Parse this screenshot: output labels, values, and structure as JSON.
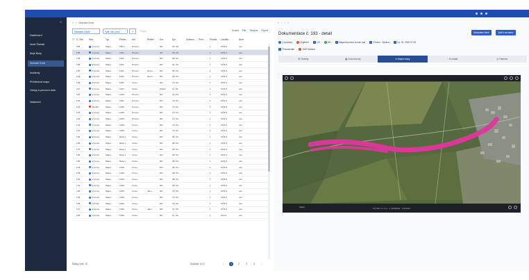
{
  "app": {
    "title": "",
    "user": ""
  },
  "sidebar": {
    "items": [
      {
        "label": "Dashboard"
      },
      {
        "label": "Nové Žádosti"
      },
      {
        "label": "Moje Body"
      },
      {
        "label": "Seznam Kont"
      },
      {
        "label": "Incidenty"
      },
      {
        "label": "Přehledová mapa"
      },
      {
        "label": "Vstupy a provozní data"
      },
      {
        "label": "Nastavení"
      }
    ]
  },
  "breadcrumb": {
    "home_icon": "home-icon",
    "label": "Seznam Kont"
  },
  "filters": {
    "select_label": "Seznam Úlohl",
    "chip_label": "Vyhl. ole: (xxx)",
    "chip_btn": "+",
    "extra": "Pro(c)",
    "actions": [
      "Invece",
      "Filtr",
      "Sloupce",
      "Export"
    ]
  },
  "table": {
    "columns": [
      "Č. Žád.",
      "Stav",
      "Typ",
      "Předm.",
      "Akt.",
      "Řešitel",
      "Kor.",
      "Spr.",
      "Ustaven.",
      "Prod.",
      "Priorita",
      "Lokalita",
      "Akce"
    ],
    "rows": [
      {
        "num": "158",
        "dot": "blue",
        "state": "V proce",
        "type": "Mapa..",
        "pred": "180.1..",
        "akt": "Provoz..",
        "ret": "",
        "kor": "ND",
        "spr": "0V. 05..",
        "ust": "",
        "prod": "",
        "prio": "1",
        "lok": "SÚS K..",
        "akce": "oss"
      },
      {
        "num": "155",
        "dot": "blue",
        "state": "V proce",
        "type": "Mapa..",
        "pred": "1101..",
        "akt": "Provoz..",
        "ret": "",
        "kor": "ND",
        "spr": "05. 05..",
        "ust": "",
        "prod": "",
        "prio": "1",
        "lok": "SÚS K..",
        "akce": "oss"
      },
      {
        "num": "153",
        "dot": "blue",
        "state": "V proce",
        "type": "Mapa..",
        "pred": "1101..",
        "akt": "Provoz..",
        "ret": "",
        "kor": "ND",
        "spr": "05. 04..",
        "ust": "",
        "prod": "",
        "prio": "1",
        "lok": "SÚS K..",
        "akce": "oss"
      },
      {
        "num": "152",
        "dot": "blue",
        "state": "V proce",
        "type": "Mapa..",
        "pred": "1101..",
        "akt": "Provoz..",
        "ret": "",
        "kor": "ND",
        "spr": "00. 04..",
        "ust": "",
        "prod": "",
        "prio": "1",
        "lok": "SÚS K..",
        "akce": "oss"
      },
      {
        "num": "155",
        "dot": "blue",
        "state": "V proce",
        "type": "Mapa..",
        "pred": "1101..",
        "akt": "Provoz..",
        "ret": "Zeme..",
        "kor": "ND",
        "spr": "03. 04..",
        "ust": "",
        "prod": "",
        "prio": "1",
        "lok": "SÚS K..",
        "akce": "oss"
      },
      {
        "num": "149",
        "dot": "blue",
        "state": "V proce",
        "type": "Mapa..",
        "pred": "1411..",
        "akt": "Provoz..",
        "ret": "Zeme..",
        "kor": "ND",
        "spr": "28. 03..",
        "ust": "",
        "prod": "",
        "prio": "1",
        "lok": "SÚS K..",
        "akce": "oss"
      },
      {
        "num": "148",
        "dot": "blue",
        "state": "V proce",
        "type": "Mapa..",
        "pred": "1131..",
        "akt": "Unive..",
        "ret": "",
        "kor": "ND",
        "spr": "15. 02..",
        "ust": "",
        "prod": "",
        "prio": "1",
        "lok": "SÚS K..",
        "akce": "oss"
      },
      {
        "num": "147",
        "dot": "blue",
        "state": "V proce",
        "type": "Mapa..",
        "pred": "1027..",
        "akt": "Unive..",
        "ret": "",
        "kor": "Znácil",
        "spr": "11. 04..",
        "ust": "",
        "prod": "",
        "prio": "1",
        "lok": "SÚS K..",
        "akce": "oss"
      },
      {
        "num": "146",
        "dot": "blue",
        "state": "V proce",
        "type": "Mapa..",
        "pred": "1180..",
        "akt": "Provoz..",
        "ret": "",
        "kor": "ND",
        "spr": "22. 03..",
        "ust": "",
        "prod": "",
        "prio": "1",
        "lok": "SÚS K..",
        "akce": "oss"
      },
      {
        "num": "145",
        "dot": "blue",
        "state": "V proce",
        "type": "Mapa..",
        "pred": "1181..",
        "akt": "Provoz..",
        "ret": "",
        "kor": "ND",
        "spr": "16. 03..",
        "ust": "",
        "prod": "",
        "prio": "1",
        "lok": "SÚS K..",
        "akce": "oss"
      },
      {
        "num": "144",
        "dot": "red",
        "state": "Zamítn.",
        "type": "Mapa..",
        "pred": "1180..",
        "akt": "Provoz..",
        "ret": "",
        "kor": "ND",
        "spr": "13. 02..",
        "ust": "",
        "prod": "",
        "prio": "1",
        "lok": "SÚS K..",
        "akce": "oss"
      },
      {
        "num": "143",
        "dot": "blue",
        "state": "V proce",
        "type": "Mapa..",
        "pred": "1180..",
        "akt": "Provoz..",
        "ret": "",
        "kor": "ND",
        "spr": "13. 04..",
        "ust": "",
        "prod": "",
        "prio": "1",
        "lok": "SÚS K..",
        "akce": "oss"
      },
      {
        "num": "142",
        "dot": "blue",
        "state": "V proce",
        "type": "Mapa..",
        "pred": "1180..",
        "akt": "Provoz..",
        "ret": "",
        "kor": "ND",
        "spr": "13. 04..",
        "ust": "",
        "prod": "",
        "prio": "1",
        "lok": "SÚS K..",
        "akce": "oss"
      },
      {
        "num": "141",
        "dot": "blue",
        "state": "V proce",
        "type": "Mapa..",
        "pred": "1180..",
        "akt": "Unive..",
        "ret": "",
        "kor": "ND",
        "spr": "15. 04..",
        "ust": "",
        "prod": "",
        "prio": "1",
        "lok": "SÚS K..",
        "akce": "oss"
      },
      {
        "num": "140",
        "dot": "blue",
        "state": "V proce",
        "type": "Mapa..",
        "pred": "1180..",
        "akt": "Unive..",
        "ret": "",
        "kor": "ND",
        "spr": "15. 04..",
        "ust": "",
        "prod": "",
        "prio": "1",
        "lok": "SÚS K..",
        "akce": "oss"
      },
      {
        "num": "139",
        "dot": "blue",
        "state": "V proce",
        "type": "Mapa..",
        "pred": "Nasu t..",
        "akt": "Unive..",
        "ret": "",
        "kor": "ND",
        "spr": "08. 04..",
        "ust": "",
        "prod": "",
        "prio": "1",
        "lok": "SÚS K..",
        "akce": "oss"
      },
      {
        "num": "138",
        "dot": "blue",
        "state": "V proce",
        "type": "Mapa..",
        "pred": "Nasu t..",
        "akt": "Unive..",
        "ret": "",
        "kor": "ND",
        "spr": "08. 04..",
        "ust": "",
        "prod": "",
        "prio": "1",
        "lok": "SÚS K..",
        "akce": "oss"
      },
      {
        "num": "137",
        "dot": "blue",
        "state": "V proce",
        "type": "Mapa..",
        "pred": "Nasu t..",
        "akt": "Unive..",
        "ret": "",
        "kor": "ND",
        "spr": "08. 04..",
        "ust": "",
        "prod": "",
        "prio": "1",
        "lok": "SÚS K..",
        "akce": "oss"
      },
      {
        "num": "136",
        "dot": "blue",
        "state": "V proce",
        "type": "Mapa..",
        "pred": "Nasu t..",
        "akt": "Unive..",
        "ret": "",
        "kor": "ND",
        "spr": "08. 03..",
        "ust": "",
        "prod": "",
        "prio": "1",
        "lok": "SÚS K..",
        "akce": "oss"
      },
      {
        "num": "135",
        "dot": "blue",
        "state": "V proce",
        "type": "Mapa..",
        "pred": "Nasu t..",
        "akt": "Unive..",
        "ret": "",
        "kor": "ND",
        "spr": "08. 03..",
        "ust": "",
        "prod": "",
        "prio": "1",
        "lok": "SÚS K..",
        "akce": "oss"
      },
      {
        "num": "134",
        "dot": "blue",
        "state": "V proce",
        "type": "Mapa..",
        "pred": "1020..",
        "akt": "Unive..",
        "ret": "",
        "kor": "ND",
        "spr": "08. 03..",
        "ust": "",
        "prod": "",
        "prio": "1",
        "lok": "SÚS K..",
        "akce": "oss"
      },
      {
        "num": "133",
        "dot": "blue",
        "state": "V proce",
        "type": "Mapa..",
        "pred": "1020..",
        "akt": "Unive..",
        "ret": "",
        "kor": "ND",
        "spr": "08. 03..",
        "ust": "",
        "prod": "",
        "prio": "1",
        "lok": "SÚS K..",
        "akce": "oss"
      },
      {
        "num": "132",
        "dot": "blue",
        "state": "V proce",
        "type": "Mapa..",
        "pred": "1020..",
        "akt": "Unive..",
        "ret": "",
        "kor": "ND",
        "spr": "08. 03..",
        "ust": "",
        "prod": "",
        "prio": "1",
        "lok": "SÚS K..",
        "akce": "oss"
      },
      {
        "num": "131",
        "dot": "blue",
        "state": "V proce",
        "type": "Mapa..",
        "pred": "1020..",
        "akt": "Unive..",
        "ret": "",
        "kor": "ND",
        "spr": "08. 03..",
        "ust": "",
        "prod": "",
        "prio": "1",
        "lok": "SÚS K..",
        "akce": "oss"
      },
      {
        "num": "130",
        "dot": "blue",
        "state": "V proce",
        "type": "Mapa..",
        "pred": "1020..",
        "akt": "Unive..",
        "ret": "Jahn..",
        "kor": "ND",
        "spr": "15. 03..",
        "ust": "",
        "prod": "",
        "prio": "1",
        "lok": "SÚS K..",
        "akce": "oss"
      },
      {
        "num": "129",
        "dot": "blue",
        "state": "V proce",
        "type": "Mapa..",
        "pred": "1020..",
        "akt": "Unive..",
        "ret": "",
        "kor": "ND",
        "spr": "13. 03..",
        "ust": "",
        "prod": "",
        "prio": "1",
        "lok": "SÚS K..",
        "akce": "oss"
      },
      {
        "num": "128",
        "dot": "blue",
        "state": "Schvál.",
        "type": "Mapa..",
        "pred": "1020..",
        "akt": "Unive..",
        "ret": "",
        "kor": "ND",
        "spr": "16. 03..",
        "ust": "",
        "prod": "",
        "prio": "1",
        "lok": "SÚS K..",
        "akce": "oss"
      },
      {
        "num": "127",
        "dot": "blue",
        "state": "V proce",
        "type": "Mapa..",
        "pred": "1020..",
        "akt": "Unive..",
        "ret": "Jahn..",
        "kor": "ND",
        "spr": "14. 03..",
        "ust": "",
        "prod": "",
        "prio": "1",
        "lok": "SÚS K..",
        "akce": "oss"
      },
      {
        "num": "126",
        "dot": "blue",
        "state": "V proce",
        "type": "Mapa..",
        "pred": "1020..",
        "akt": "Unive..",
        "ret": "",
        "kor": "ND",
        "spr": "11. 03..",
        "ust": "",
        "prod": "",
        "prio": "1",
        "lok": "Zvolá..",
        "akce": "oss"
      }
    ]
  },
  "pagination": {
    "count": "Řádky celé: 10",
    "per_page": "Zobrazit: 10 ▾",
    "pages": [
      "‹",
      "1",
      "2",
      "3",
      "4",
      "›"
    ]
  },
  "detail": {
    "nav": [
      "«",
      "‹",
      "›",
      "»"
    ],
    "title": "Dokumentace č. 193 - detail",
    "btn1": "Akceptace Akce",
    "btn2": "Zpět k seznamu",
    "info1": [
      {
        "icon": "blue",
        "text": "V procesu"
      },
      {
        "icon": "red",
        "text": "Urgentní"
      },
      {
        "icon": "sq",
        "text": "1/3"
      },
      {
        "icon": "green",
        "text": "ND"
      },
      {
        "icon": "sq",
        "text": "Mapová pomoc zvoucí nad"
      },
      {
        "icon": "sq",
        "text": "Provoz - Správa"
      },
      {
        "icon": "sq",
        "text": "Cs. 02. 2024 07:19"
      }
    ],
    "info2": [
      {
        "icon": "sq",
        "text": "Provozování"
      },
      {
        "icon": "red",
        "text": "SÚS Morava"
      }
    ]
  },
  "tabs": [
    {
      "label": "Detaily"
    },
    {
      "label": "Dokumenty"
    },
    {
      "label": "Mapa trasy"
    },
    {
      "label": "Kontakt"
    },
    {
      "label": "Historie"
    }
  ],
  "map": {
    "coords": "5 5 756 / 2 / 4.4  ·  s: 39.56632   · 1:50 000  ·  ·",
    "logo": "Mapa"
  },
  "colors": {
    "topbar": "#1f4fae",
    "sidebar": "#1e2b3f",
    "active_tab": "#274e95",
    "route": "#e0359e"
  }
}
